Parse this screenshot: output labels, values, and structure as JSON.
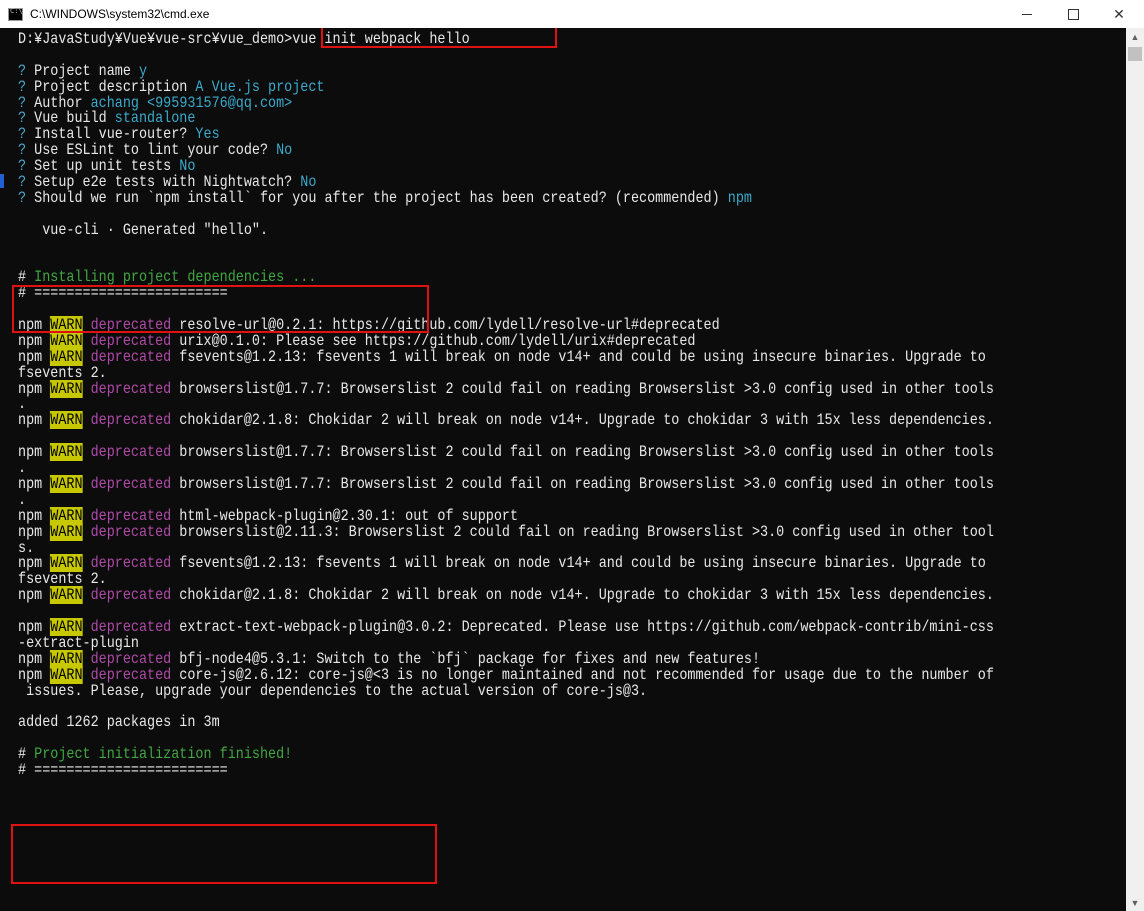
{
  "window": {
    "title": "C:\\WINDOWS\\system32\\cmd.exe",
    "min_label": "",
    "max_label": "",
    "close_label": "✕"
  },
  "console_lines": [
    {
      "segs": [
        {
          "t": "D:¥JavaStudy¥Vue¥vue-src¥vue_demo>vue init webpack hello",
          "c": ""
        }
      ]
    },
    {
      "segs": []
    },
    {
      "segs": [
        {
          "t": "? ",
          "c": "q"
        },
        {
          "t": "Project name ",
          "c": ""
        },
        {
          "t": "y",
          "c": "ans"
        }
      ]
    },
    {
      "segs": [
        {
          "t": "? ",
          "c": "q"
        },
        {
          "t": "Project description ",
          "c": ""
        },
        {
          "t": "A Vue.js project",
          "c": "ans"
        }
      ]
    },
    {
      "segs": [
        {
          "t": "? ",
          "c": "q"
        },
        {
          "t": "Author ",
          "c": ""
        },
        {
          "t": "achang <995931576@qq.com>",
          "c": "ans"
        }
      ]
    },
    {
      "segs": [
        {
          "t": "? ",
          "c": "q"
        },
        {
          "t": "Vue build ",
          "c": ""
        },
        {
          "t": "standalone",
          "c": "ans"
        }
      ]
    },
    {
      "segs": [
        {
          "t": "? ",
          "c": "q"
        },
        {
          "t": "Install vue-router? ",
          "c": ""
        },
        {
          "t": "Yes",
          "c": "ans"
        }
      ]
    },
    {
      "segs": [
        {
          "t": "? ",
          "c": "q"
        },
        {
          "t": "Use ESLint to lint your code? ",
          "c": ""
        },
        {
          "t": "No",
          "c": "ans"
        }
      ]
    },
    {
      "segs": [
        {
          "t": "? ",
          "c": "q"
        },
        {
          "t": "Set up unit tests ",
          "c": ""
        },
        {
          "t": "No",
          "c": "ans"
        }
      ]
    },
    {
      "segs": [
        {
          "t": "? ",
          "c": "q"
        },
        {
          "t": "Setup e2e tests with Nightwatch? ",
          "c": ""
        },
        {
          "t": "No",
          "c": "ans"
        }
      ]
    },
    {
      "segs": [
        {
          "t": "? ",
          "c": "q"
        },
        {
          "t": "Should we run `npm install` for you after the project has been created? (recommended) ",
          "c": ""
        },
        {
          "t": "npm",
          "c": "ans"
        }
      ]
    },
    {
      "segs": []
    },
    {
      "segs": [
        {
          "t": "   vue-cli · Generated \"hello\".",
          "c": ""
        }
      ]
    },
    {
      "segs": []
    },
    {
      "segs": []
    },
    {
      "segs": [
        {
          "t": "# ",
          "c": ""
        },
        {
          "t": "Installing project dependencies ...",
          "c": "g"
        }
      ]
    },
    {
      "segs": [
        {
          "t": "# ========================",
          "c": ""
        }
      ]
    },
    {
      "segs": []
    },
    {
      "segs": [
        {
          "t": "npm ",
          "c": ""
        },
        {
          "t": "WARN",
          "c": "warn"
        },
        {
          "t": " deprecated ",
          "c": "dep"
        },
        {
          "t": "resolve-url@0.2.1: https://github.com/lydell/resolve-url#deprecated",
          "c": ""
        }
      ]
    },
    {
      "segs": [
        {
          "t": "npm ",
          "c": ""
        },
        {
          "t": "WARN",
          "c": "warn"
        },
        {
          "t": " deprecated ",
          "c": "dep"
        },
        {
          "t": "urix@0.1.0: Please see https://github.com/lydell/urix#deprecated",
          "c": ""
        }
      ]
    },
    {
      "segs": [
        {
          "t": "npm ",
          "c": ""
        },
        {
          "t": "WARN",
          "c": "warn"
        },
        {
          "t": " deprecated ",
          "c": "dep"
        },
        {
          "t": "fsevents@1.2.13: fsevents 1 will break on node v14+ and could be using insecure binaries. Upgrade to",
          "c": ""
        }
      ]
    },
    {
      "segs": [
        {
          "t": "fsevents 2.",
          "c": ""
        }
      ]
    },
    {
      "segs": [
        {
          "t": "npm ",
          "c": ""
        },
        {
          "t": "WARN",
          "c": "warn"
        },
        {
          "t": " deprecated ",
          "c": "dep"
        },
        {
          "t": "browserslist@1.7.7: Browserslist 2 could fail on reading Browserslist >3.0 config used in other tools",
          "c": ""
        }
      ]
    },
    {
      "segs": [
        {
          "t": ".",
          "c": ""
        }
      ]
    },
    {
      "segs": [
        {
          "t": "npm ",
          "c": ""
        },
        {
          "t": "WARN",
          "c": "warn"
        },
        {
          "t": " deprecated ",
          "c": "dep"
        },
        {
          "t": "chokidar@2.1.8: Chokidar 2 will break on node v14+. Upgrade to chokidar 3 with 15x less dependencies.",
          "c": ""
        }
      ]
    },
    {
      "segs": []
    },
    {
      "segs": [
        {
          "t": "npm ",
          "c": ""
        },
        {
          "t": "WARN",
          "c": "warn"
        },
        {
          "t": " deprecated ",
          "c": "dep"
        },
        {
          "t": "browserslist@1.7.7: Browserslist 2 could fail on reading Browserslist >3.0 config used in other tools",
          "c": ""
        }
      ]
    },
    {
      "segs": [
        {
          "t": ".",
          "c": ""
        }
      ]
    },
    {
      "segs": [
        {
          "t": "npm ",
          "c": ""
        },
        {
          "t": "WARN",
          "c": "warn"
        },
        {
          "t": " deprecated ",
          "c": "dep"
        },
        {
          "t": "browserslist@1.7.7: Browserslist 2 could fail on reading Browserslist >3.0 config used in other tools",
          "c": ""
        }
      ]
    },
    {
      "segs": [
        {
          "t": ".",
          "c": ""
        }
      ]
    },
    {
      "segs": [
        {
          "t": "npm ",
          "c": ""
        },
        {
          "t": "WARN",
          "c": "warn"
        },
        {
          "t": " deprecated ",
          "c": "dep"
        },
        {
          "t": "html-webpack-plugin@2.30.1: out of support",
          "c": ""
        }
      ]
    },
    {
      "segs": [
        {
          "t": "npm ",
          "c": ""
        },
        {
          "t": "WARN",
          "c": "warn"
        },
        {
          "t": " deprecated ",
          "c": "dep"
        },
        {
          "t": "browserslist@2.11.3: Browserslist 2 could fail on reading Browserslist >3.0 config used in other tool",
          "c": ""
        }
      ]
    },
    {
      "segs": [
        {
          "t": "s.",
          "c": ""
        }
      ]
    },
    {
      "segs": [
        {
          "t": "npm ",
          "c": ""
        },
        {
          "t": "WARN",
          "c": "warn"
        },
        {
          "t": " deprecated ",
          "c": "dep"
        },
        {
          "t": "fsevents@1.2.13: fsevents 1 will break on node v14+ and could be using insecure binaries. Upgrade to",
          "c": ""
        }
      ]
    },
    {
      "segs": [
        {
          "t": "fsevents 2.",
          "c": ""
        }
      ]
    },
    {
      "segs": [
        {
          "t": "npm ",
          "c": ""
        },
        {
          "t": "WARN",
          "c": "warn"
        },
        {
          "t": " deprecated ",
          "c": "dep"
        },
        {
          "t": "chokidar@2.1.8: Chokidar 2 will break on node v14+. Upgrade to chokidar 3 with 15x less dependencies.",
          "c": ""
        }
      ]
    },
    {
      "segs": []
    },
    {
      "segs": [
        {
          "t": "npm ",
          "c": ""
        },
        {
          "t": "WARN",
          "c": "warn"
        },
        {
          "t": " deprecated ",
          "c": "dep"
        },
        {
          "t": "extract-text-webpack-plugin@3.0.2: Deprecated. Please use https://github.com/webpack-contrib/mini-css",
          "c": ""
        }
      ]
    },
    {
      "segs": [
        {
          "t": "-extract-plugin",
          "c": ""
        }
      ]
    },
    {
      "segs": [
        {
          "t": "npm ",
          "c": ""
        },
        {
          "t": "WARN",
          "c": "warn"
        },
        {
          "t": " deprecated ",
          "c": "dep"
        },
        {
          "t": "bfj-node4@5.3.1: Switch to the `bfj` package for fixes and new features!",
          "c": ""
        }
      ]
    },
    {
      "segs": [
        {
          "t": "npm ",
          "c": ""
        },
        {
          "t": "WARN",
          "c": "warn"
        },
        {
          "t": " deprecated ",
          "c": "dep"
        },
        {
          "t": "core-js@2.6.12: core-js@<3 is no longer maintained and not recommended for usage due to the number of",
          "c": ""
        }
      ]
    },
    {
      "segs": [
        {
          "t": " issues. Please, upgrade your dependencies to the actual version of core-js@3.",
          "c": ""
        }
      ]
    },
    {
      "segs": []
    },
    {
      "segs": [
        {
          "t": "added 1262 packages in 3m",
          "c": ""
        }
      ]
    },
    {
      "segs": []
    },
    {
      "segs": [
        {
          "t": "# ",
          "c": ""
        },
        {
          "t": "Project initialization finished!",
          "c": "g"
        }
      ]
    },
    {
      "segs": [
        {
          "t": "# ========================",
          "c": ""
        }
      ]
    }
  ],
  "colors": {
    "console_bg": "#0c0c0c",
    "text": "#e8e8e8",
    "prompt_q": "#4aa8c9",
    "answer": "#3ba9c9",
    "green": "#41a841",
    "warn_bg": "#c8c800",
    "deprecated": "#b04aa8",
    "highlight_box": "#e0120f"
  },
  "icons": [
    "cmd-icon",
    "minimize-icon",
    "maximize-icon",
    "close-icon",
    "scroll-up-icon",
    "scroll-down-icon"
  ]
}
